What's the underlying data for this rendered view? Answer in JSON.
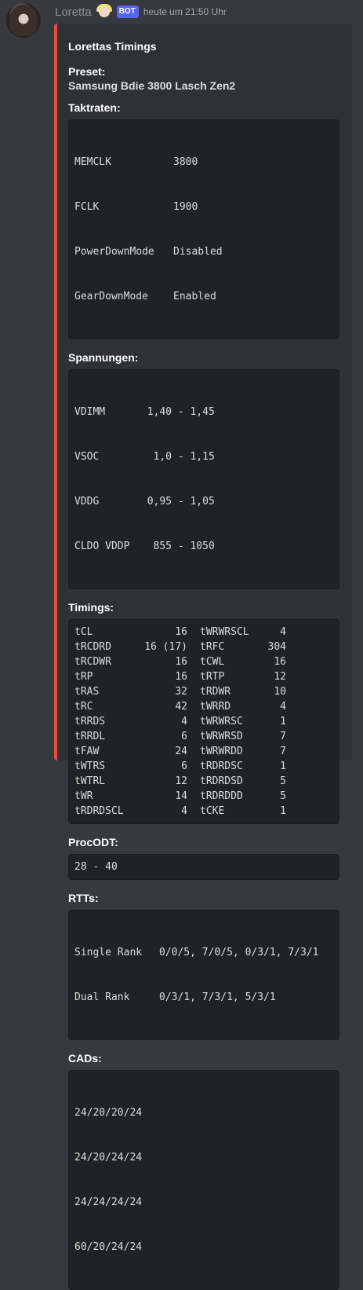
{
  "message": {
    "author": "Loretta",
    "badge": "BOT",
    "timestamp": "heute um 21:50 Uhr"
  },
  "embed": {
    "accent_color": "#e74c3c",
    "title": "Lorettas Timings",
    "preset": {
      "name": "Preset:",
      "value": "Samsung Bdie 3800 Lasch Zen2"
    },
    "taktraten": {
      "name": "Taktraten:",
      "rows": [
        {
          "k": "MEMCLK",
          "v": "3800"
        },
        {
          "k": "FCLK",
          "v": "1900"
        },
        {
          "k": "PowerDownMode",
          "v": "Disabled"
        },
        {
          "k": "GearDownMode",
          "v": "Enabled"
        }
      ]
    },
    "spannungen": {
      "name": "Spannungen:",
      "rows": [
        {
          "k": "VDIMM",
          "a": "1,40",
          "b": "1,45"
        },
        {
          "k": "VSOC",
          "a": "1,0",
          "b": "1,15"
        },
        {
          "k": "VDDG",
          "a": "0,95",
          "b": "1,05"
        },
        {
          "k": "CLDO VDDP",
          "a": "855",
          "b": "1050"
        }
      ]
    },
    "timings": {
      "name": "Timings:",
      "rows": [
        {
          "k1": "tCL",
          "v1": "16",
          "k2": "tWRWRSCL",
          "v2": "4"
        },
        {
          "k1": "tRCDRD",
          "v1": "16 (17)",
          "k2": "tRFC",
          "v2": "304"
        },
        {
          "k1": "tRCDWR",
          "v1": "16",
          "k2": "tCWL",
          "v2": "16"
        },
        {
          "k1": "tRP",
          "v1": "16",
          "k2": "tRTP",
          "v2": "12"
        },
        {
          "k1": "tRAS",
          "v1": "32",
          "k2": "tRDWR",
          "v2": "10"
        },
        {
          "k1": "tRC",
          "v1": "42",
          "k2": "tWRRD",
          "v2": "4"
        },
        {
          "k1": "tRRDS",
          "v1": "4",
          "k2": "tWRWRSC",
          "v2": "1"
        },
        {
          "k1": "tRRDL",
          "v1": "6",
          "k2": "tWRWRSD",
          "v2": "7"
        },
        {
          "k1": "tFAW",
          "v1": "24",
          "k2": "tWRWRDD",
          "v2": "7"
        },
        {
          "k1": "tWTRS",
          "v1": "6",
          "k2": "tRDRDSC",
          "v2": "1"
        },
        {
          "k1": "tWTRL",
          "v1": "12",
          "k2": "tRDRDSD",
          "v2": "5"
        },
        {
          "k1": "tWR",
          "v1": "14",
          "k2": "tRDRDDD",
          "v2": "5"
        },
        {
          "k1": "tRDRDSCL",
          "v1": "4",
          "k2": "tCKE",
          "v2": "1"
        }
      ]
    },
    "procodt": {
      "name": "ProcODT:",
      "value": "28 - 40"
    },
    "rtts": {
      "name": "RTTs:",
      "rows": [
        {
          "k": "Single Rank",
          "v": "0/0/5, 7/0/5, 0/3/1, 7/3/1"
        },
        {
          "k": "Dual Rank",
          "v": "0/3/1, 7/3/1, 5/3/1"
        }
      ]
    },
    "cads": {
      "name": "CADs:",
      "lines": [
        "24/20/20/24",
        "24/20/24/24",
        "24/24/24/24",
        "60/20/24/24"
      ]
    }
  }
}
